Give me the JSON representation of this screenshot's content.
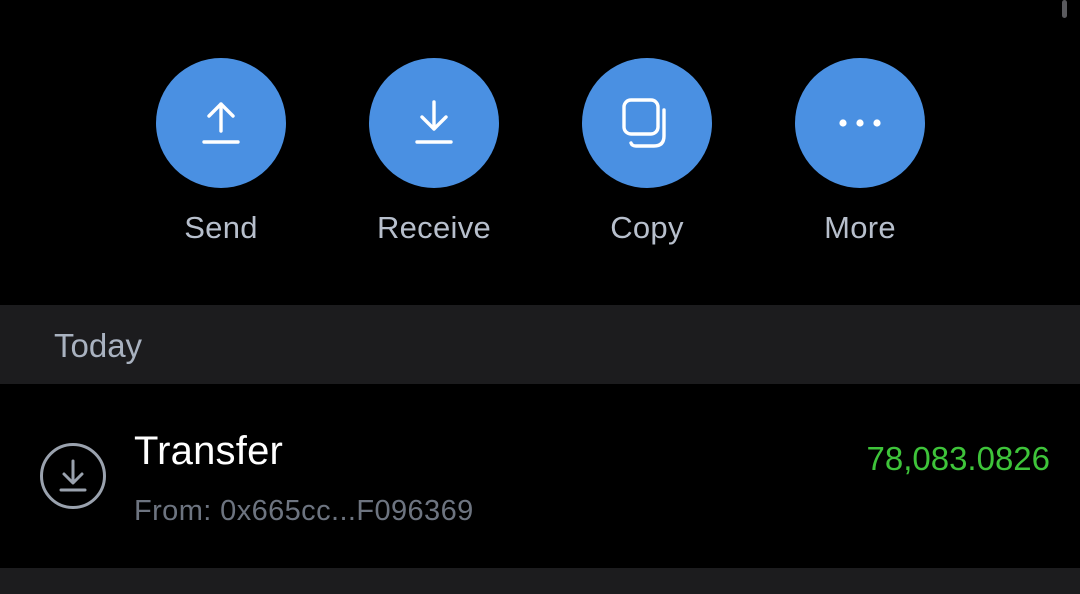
{
  "colors": {
    "background": "#000000",
    "accent": "#4a90e2",
    "section_background": "#1c1c1e",
    "action_label": "#b7bfcc",
    "amount_positive": "#3ec43a"
  },
  "actions": [
    {
      "label": "Send",
      "icon": "upload-arrow-icon"
    },
    {
      "label": "Receive",
      "icon": "download-arrow-icon"
    },
    {
      "label": "Copy",
      "icon": "copy-icon"
    },
    {
      "label": "More",
      "icon": "more-dots-icon"
    }
  ],
  "history": {
    "section_title": "Today",
    "transactions": [
      {
        "type": "Transfer",
        "from": "From: 0x665cc...F096369",
        "amount": "78,083.0826",
        "icon": "incoming-transfer-icon"
      }
    ]
  }
}
